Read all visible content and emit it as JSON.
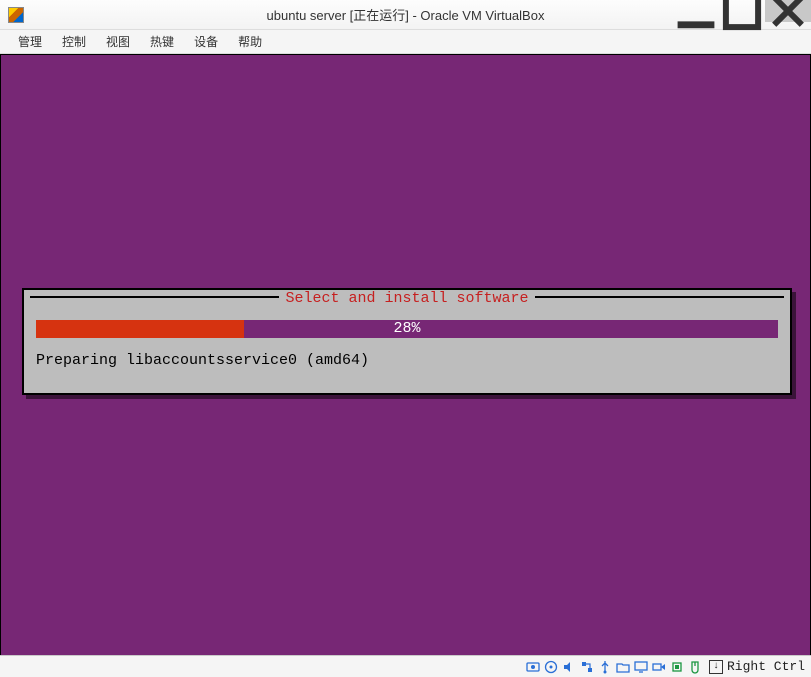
{
  "window": {
    "title": "ubuntu server [正在运行] - Oracle VM VirtualBox"
  },
  "menubar": {
    "items": [
      "管理",
      "控制",
      "视图",
      "热键",
      "设备",
      "帮助"
    ]
  },
  "installer": {
    "title": "Select and install software",
    "progress_pct": 28,
    "progress_label": "28%",
    "status": "Preparing libaccountsservice0 (amd64)"
  },
  "statusbar": {
    "host_key": "Right Ctrl",
    "icons": [
      "hard-disk-icon",
      "optical-disk-icon",
      "audio-icon",
      "network-icon",
      "usb-icon",
      "shared-folder-icon",
      "display-icon",
      "recording-icon",
      "cpu-icon",
      "mouse-integration-icon"
    ]
  },
  "colors": {
    "vm_bg": "#772775",
    "progress_fill": "#d63310",
    "title_red": "#c62020",
    "box_gray": "#bdbdbd"
  }
}
